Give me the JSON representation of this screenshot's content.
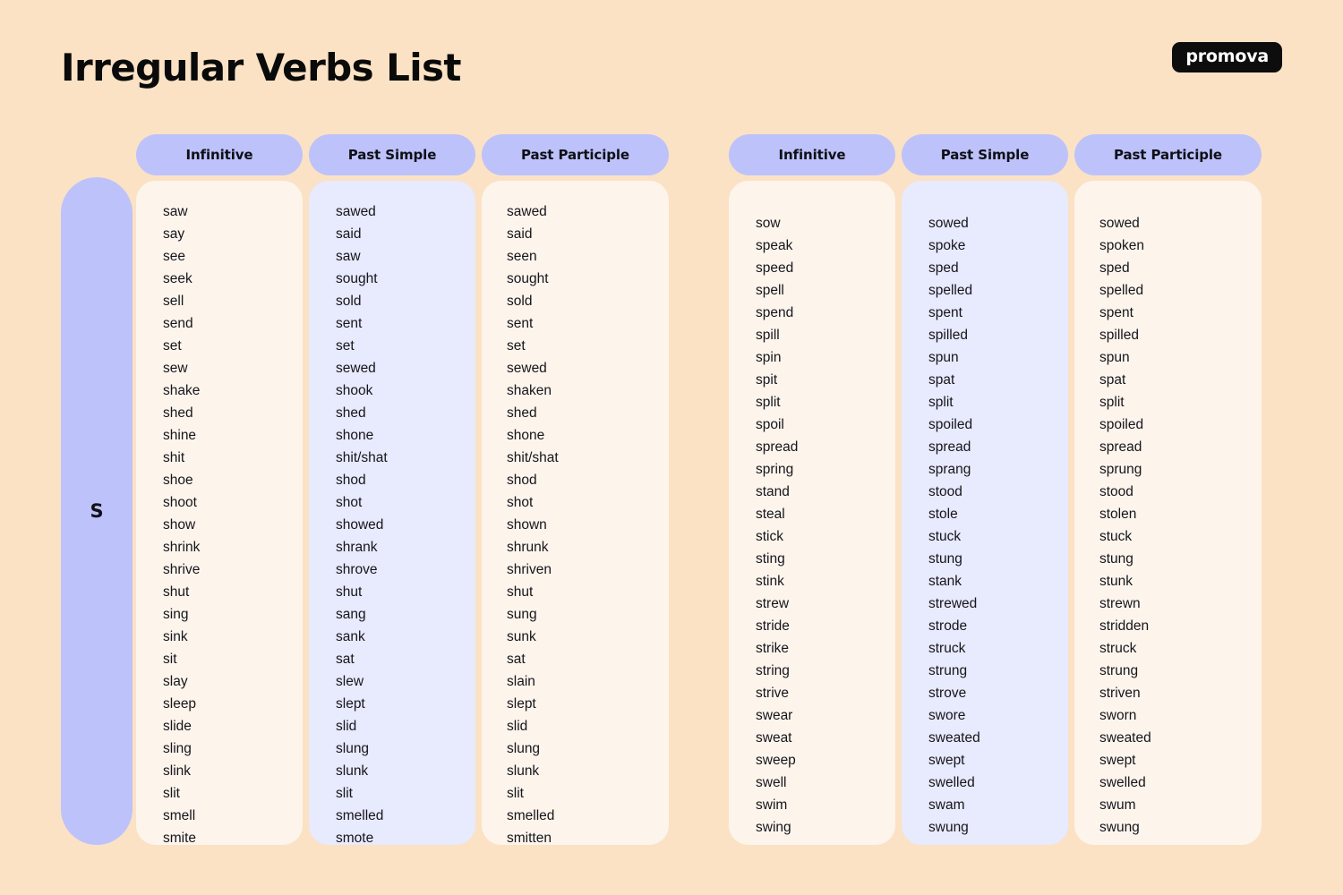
{
  "header": {
    "title": "Irregular Verbs List",
    "brand": "promova"
  },
  "letter_rail": {
    "letter": "S"
  },
  "column_headers": {
    "infinitive": "Infinitive",
    "past_simple": "Past Simple",
    "past_participle": "Past Participle"
  },
  "colors": {
    "page_background": "#fbe2c5",
    "accent_lavender": "#bdc2fa",
    "panel_cream": "#fdf5ec",
    "panel_lilac": "#e8eafd",
    "text": "#15151c",
    "logo_background": "#0d0d0d",
    "logo_text": "#ffffff"
  },
  "tables": [
    {
      "name": "left-table",
      "headers": [
        "Infinitive",
        "Past Simple",
        "Past Participle"
      ],
      "rows": [
        [
          "saw",
          "sawed",
          "sawed"
        ],
        [
          "say",
          "said",
          "said"
        ],
        [
          "see",
          "saw",
          "seen"
        ],
        [
          "seek",
          "sought",
          "sought"
        ],
        [
          "sell",
          "sold",
          "sold"
        ],
        [
          "send",
          "sent",
          "sent"
        ],
        [
          "set",
          "set",
          "set"
        ],
        [
          "sew",
          "sewed",
          "sewed"
        ],
        [
          "shake",
          "shook",
          "shaken"
        ],
        [
          "shed",
          "shed",
          "shed"
        ],
        [
          "shine",
          "shone",
          "shone"
        ],
        [
          "shit",
          "shit/shat",
          "shit/shat"
        ],
        [
          "shoe",
          "shod",
          "shod"
        ],
        [
          "shoot",
          "shot",
          "shot"
        ],
        [
          "show",
          "showed",
          "shown"
        ],
        [
          "shrink",
          "shrank",
          "shrunk"
        ],
        [
          "shrive",
          "shrove",
          "shriven"
        ],
        [
          "shut",
          "shut",
          "shut"
        ],
        [
          "sing",
          "sang",
          "sung"
        ],
        [
          "sink",
          "sank",
          "sunk"
        ],
        [
          "sit",
          "sat",
          "sat"
        ],
        [
          "slay",
          "slew",
          "slain"
        ],
        [
          "sleep",
          "slept",
          "slept"
        ],
        [
          "slide",
          "slid",
          "slid"
        ],
        [
          "sling",
          "slung",
          "slung"
        ],
        [
          "slink",
          "slunk",
          "slunk"
        ],
        [
          "slit",
          "slit",
          "slit"
        ],
        [
          "smell",
          "smelled",
          "smelled"
        ],
        [
          "smite",
          "smote",
          "smitten"
        ]
      ]
    },
    {
      "name": "right-table",
      "headers": [
        "Infinitive",
        "Past Simple",
        "Past Participle"
      ],
      "rows": [
        [
          "sow",
          "sowed",
          "sowed"
        ],
        [
          "speak",
          "spoke",
          "spoken"
        ],
        [
          "speed",
          "sped",
          "sped"
        ],
        [
          "spell",
          "spelled",
          "spelled"
        ],
        [
          "spend",
          "spent",
          "spent"
        ],
        [
          "spill",
          "spilled",
          "spilled"
        ],
        [
          "spin",
          "spun",
          "spun"
        ],
        [
          "spit",
          "spat",
          "spat"
        ],
        [
          "split",
          "split",
          "split"
        ],
        [
          "spoil",
          "spoiled",
          "spoiled"
        ],
        [
          "spread",
          "spread",
          "spread"
        ],
        [
          "spring",
          "sprang",
          "sprung"
        ],
        [
          "stand",
          "stood",
          "stood"
        ],
        [
          "steal",
          "stole",
          "stolen"
        ],
        [
          "stick",
          "stuck",
          "stuck"
        ],
        [
          "sting",
          "stung",
          "stung"
        ],
        [
          "stink",
          "stank",
          "stunk"
        ],
        [
          "strew",
          "strewed",
          "strewn"
        ],
        [
          "stride",
          "strode",
          "stridden"
        ],
        [
          "strike",
          "struck",
          "struck"
        ],
        [
          "string",
          "strung",
          "strung"
        ],
        [
          "strive",
          "strove",
          "striven"
        ],
        [
          "swear",
          "swore",
          "sworn"
        ],
        [
          "sweat",
          "sweated",
          "sweated"
        ],
        [
          "sweep",
          "swept",
          "swept"
        ],
        [
          "swell",
          "swelled",
          "swelled"
        ],
        [
          "swim",
          "swam",
          "swum"
        ],
        [
          "swing",
          "swung",
          "swung"
        ]
      ]
    }
  ]
}
